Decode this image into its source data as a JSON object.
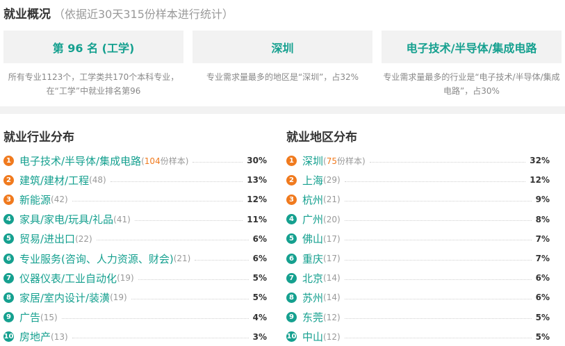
{
  "header": {
    "title": "就业概况",
    "subtitle": "（依据近30天315份样本进行统计）"
  },
  "summary": [
    {
      "value": "第 96 名 (工学)",
      "desc": "所有专业1123个，工学类共170个本科专业，在“工学”中就业排名第96"
    },
    {
      "value": "深圳",
      "desc": "专业需求量最多的地区是“深圳”，占32%"
    },
    {
      "value": "电子技术/半导体/集成电路",
      "desc": "专业需求量最多的行业是“电子技术/半导体/集成电路”，占30%"
    }
  ],
  "industry": {
    "title": "就业行业分布",
    "sample_suffix": "份样本",
    "items": [
      {
        "rank": "1",
        "name": "电子技术/半导体/集成电路",
        "count": "104",
        "pct": "30%"
      },
      {
        "rank": "2",
        "name": "建筑/建材/工程",
        "count": "(48)",
        "pct": "13%"
      },
      {
        "rank": "3",
        "name": "新能源",
        "count": "(42)",
        "pct": "12%"
      },
      {
        "rank": "4",
        "name": "家具/家电/玩具/礼品",
        "count": "(41)",
        "pct": "11%"
      },
      {
        "rank": "5",
        "name": "贸易/进出口",
        "count": "(22)",
        "pct": "6%"
      },
      {
        "rank": "6",
        "name": "专业服务(咨询、人力资源、财会)",
        "count": "(21)",
        "pct": "6%"
      },
      {
        "rank": "7",
        "name": "仪器仪表/工业自动化",
        "count": "(19)",
        "pct": "5%"
      },
      {
        "rank": "8",
        "name": "家居/室内设计/装潢",
        "count": "(19)",
        "pct": "5%"
      },
      {
        "rank": "9",
        "name": "广告",
        "count": "(15)",
        "pct": "4%"
      },
      {
        "rank": "10",
        "name": "房地产",
        "count": "(13)",
        "pct": "3%"
      }
    ]
  },
  "region": {
    "title": "就业地区分布",
    "sample_suffix": "份样本",
    "items": [
      {
        "rank": "1",
        "name": "深圳",
        "count": "75",
        "pct": "32%"
      },
      {
        "rank": "2",
        "name": "上海",
        "count": "(29)",
        "pct": "12%"
      },
      {
        "rank": "3",
        "name": "杭州",
        "count": "(21)",
        "pct": "9%"
      },
      {
        "rank": "4",
        "name": "广州",
        "count": "(20)",
        "pct": "8%"
      },
      {
        "rank": "5",
        "name": "佛山",
        "count": "(17)",
        "pct": "7%"
      },
      {
        "rank": "6",
        "name": "重庆",
        "count": "(17)",
        "pct": "7%"
      },
      {
        "rank": "7",
        "name": "北京",
        "count": "(14)",
        "pct": "6%"
      },
      {
        "rank": "8",
        "name": "苏州",
        "count": "(14)",
        "pct": "6%"
      },
      {
        "rank": "9",
        "name": "东莞",
        "count": "(12)",
        "pct": "5%"
      },
      {
        "rank": "10",
        "name": "中山",
        "count": "(12)",
        "pct": "5%"
      }
    ]
  },
  "colors": {
    "accent": "#15a08f",
    "top_rank": "#f07a1e",
    "panel_bg": "#f2f2f2"
  }
}
